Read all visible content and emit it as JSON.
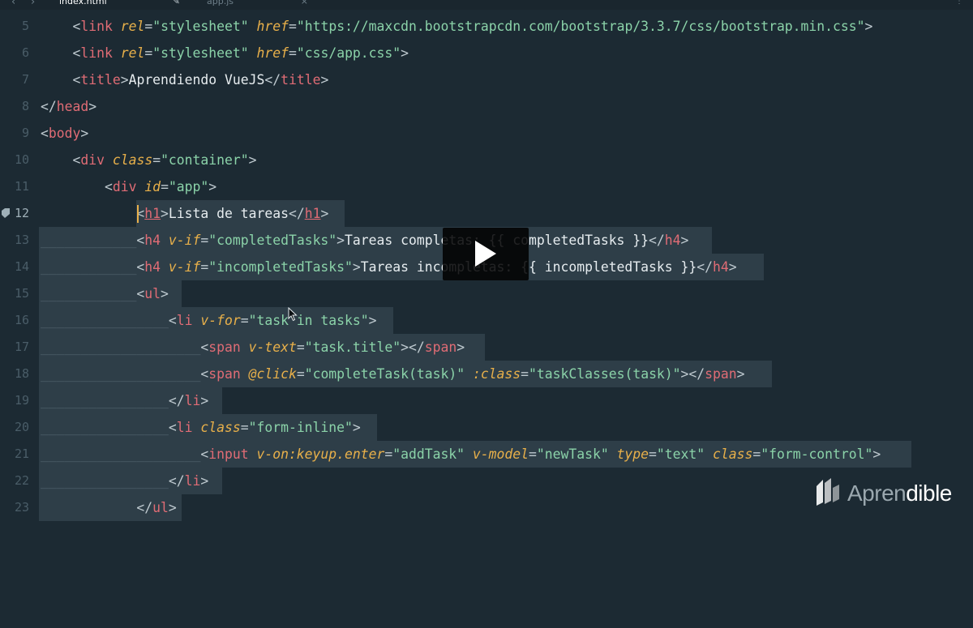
{
  "tabs": [
    {
      "label": "index.html",
      "icon": "pencil-icon"
    },
    {
      "label": "app.js",
      "icon": "close-icon"
    }
  ],
  "line_numbers": [
    "5",
    "6",
    "7",
    "8",
    "9",
    "10",
    "11",
    "12",
    "13",
    "14",
    "15",
    "16",
    "17",
    "18",
    "19",
    "20",
    "21",
    "22",
    "23"
  ],
  "code": {
    "l5": {
      "attr": "rel",
      "attr_val": "\"stylesheet\"",
      "attr2": "href",
      "attr2_val": "\"https://maxcdn.bootstrapcdn.com/bootstrap/3.3.7/css/bootstrap.min.css\""
    },
    "l6": {
      "attr_val": "\"stylesheet\"",
      "attr2_val": "\"css/app.css\""
    },
    "l7": {
      "text": "Aprendiendo VueJS"
    },
    "l10": {
      "attr": "class",
      "attr_val": "\"container\""
    },
    "l11": {
      "attr": "id",
      "attr_val": "\"app\""
    },
    "l12": {
      "text": "Lista de tareas"
    },
    "l13": {
      "attr": "v-if",
      "attr_val": "\"completedTasks\"",
      "text": "Tareas completas: {{ completedTasks }}"
    },
    "l14": {
      "attr": "v-if",
      "attr_val": "\"incompletedTasks\"",
      "text": "Tareas incompletas: {{ incompletedTasks }}"
    },
    "l16": {
      "attr": "v-for",
      "attr_val": "\"task in tasks\""
    },
    "l17": {
      "attr": "v-text",
      "attr_val": "\"task.title\""
    },
    "l18": {
      "attr": "@click",
      "attr_val": "\"completeTask(task)\"",
      "attr2": ":class",
      "attr2_val": "\"taskClasses(task)\""
    },
    "l20": {
      "attr": "class",
      "attr_val": "\"form-inline\""
    },
    "l21": {
      "attr": "v-on:keyup.enter",
      "attr_val": "\"addTask\"",
      "attr2": "v-model",
      "attr2_val": "\"newTask\"",
      "attr3": "type",
      "attr3_val": "\"text\"",
      "attr4": "class",
      "attr4_val": "\"form-control\""
    }
  },
  "tags": {
    "link": "link",
    "title": "title",
    "head": "head",
    "body": "body",
    "div": "div",
    "h1": "h1",
    "h4": "h4",
    "ul": "ul",
    "li": "li",
    "span": "span",
    "input": "input"
  },
  "overlay": {
    "icon": "play-icon"
  },
  "logo": {
    "text_light": "Apren",
    "text_bold": "dible"
  },
  "colors": {
    "background": "#1c2a33",
    "tag": "#e06c75",
    "attribute": "#e8b04a",
    "string": "#8bd3a9",
    "selection": "#2e3e48",
    "tab_accent": "#5fb3a9"
  }
}
